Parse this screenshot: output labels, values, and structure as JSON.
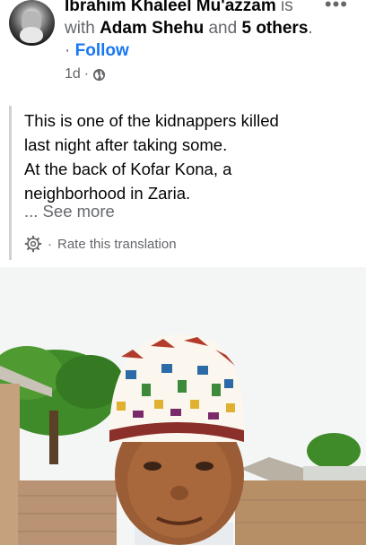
{
  "post": {
    "author": "Ibrahim Khaleel Mu'azzam",
    "with_text": "is with",
    "tagged": "Adam Shehu",
    "and_text": "and",
    "others": "5 others",
    "follow_label": "Follow",
    "time": "1d",
    "more_glyph": "•••",
    "text_lines": [
      "This is one of the kidnappers killed",
      "last night after taking some.",
      "At the back of Kofar Kona, a",
      "neighborhood in Zaria."
    ],
    "see_more": "... See more",
    "rate_translation": "Rate this translation"
  },
  "icons": {
    "avatar": "avatar",
    "globe": "globe-icon",
    "gear": "gear-icon",
    "more": "more-icon"
  },
  "colors": {
    "link": "#1877f2",
    "secondary_text": "#65676b",
    "quote_bar": "#cfd1d5"
  }
}
